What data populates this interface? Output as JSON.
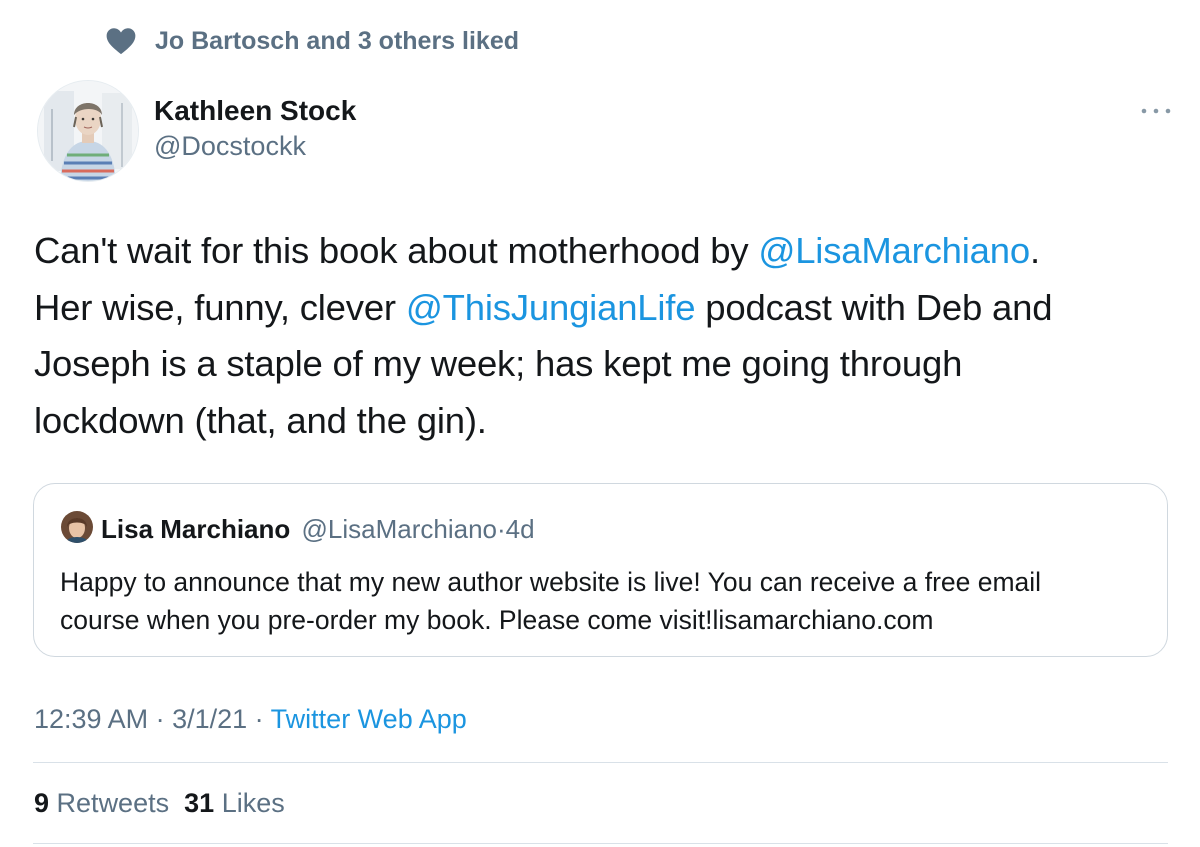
{
  "social_context": {
    "icon": "heart-icon",
    "text": "Jo Bartosch and 3 others liked"
  },
  "author": {
    "name": "Kathleen Stock",
    "handle": "@Docstockk"
  },
  "more_icon": "more-dots-icon",
  "tweet": {
    "lines": [
      {
        "before": "Can't wait for this book about motherhood by ",
        "mention": "@LisaMarchiano",
        "after": "."
      },
      {
        "before": "Her wise, funny, clever ",
        "mention": "@ThisJungianLife",
        "after": " podcast with Deb and"
      },
      {
        "before": "Joseph is a staple of my week; has kept me going through",
        "mention": "",
        "after": ""
      },
      {
        "before": "lockdown (that, and the gin).",
        "mention": "",
        "after": ""
      }
    ]
  },
  "quote": {
    "name": "Lisa Marchiano",
    "handle": "@LisaMarchiano",
    "separator": "·",
    "time": "4d",
    "text_line1": "Happy to announce that my new author website is live! You can receive a free email",
    "text_line2": "course when you pre-order my book. Please come visit!lisamarchiano.com"
  },
  "meta": {
    "time": "12:39 AM",
    "sep1": " · ",
    "date": "3/1/21",
    "sep2": " · ",
    "source": "Twitter Web App"
  },
  "stats": {
    "retweets_count": "9",
    "retweets_label": "Retweets",
    "likes_count": "31",
    "likes_label": "Likes"
  },
  "colors": {
    "link": "#1b95e0",
    "secondary_text": "#5b7083",
    "primary_text": "#14171a",
    "border": "#d0d8df"
  }
}
